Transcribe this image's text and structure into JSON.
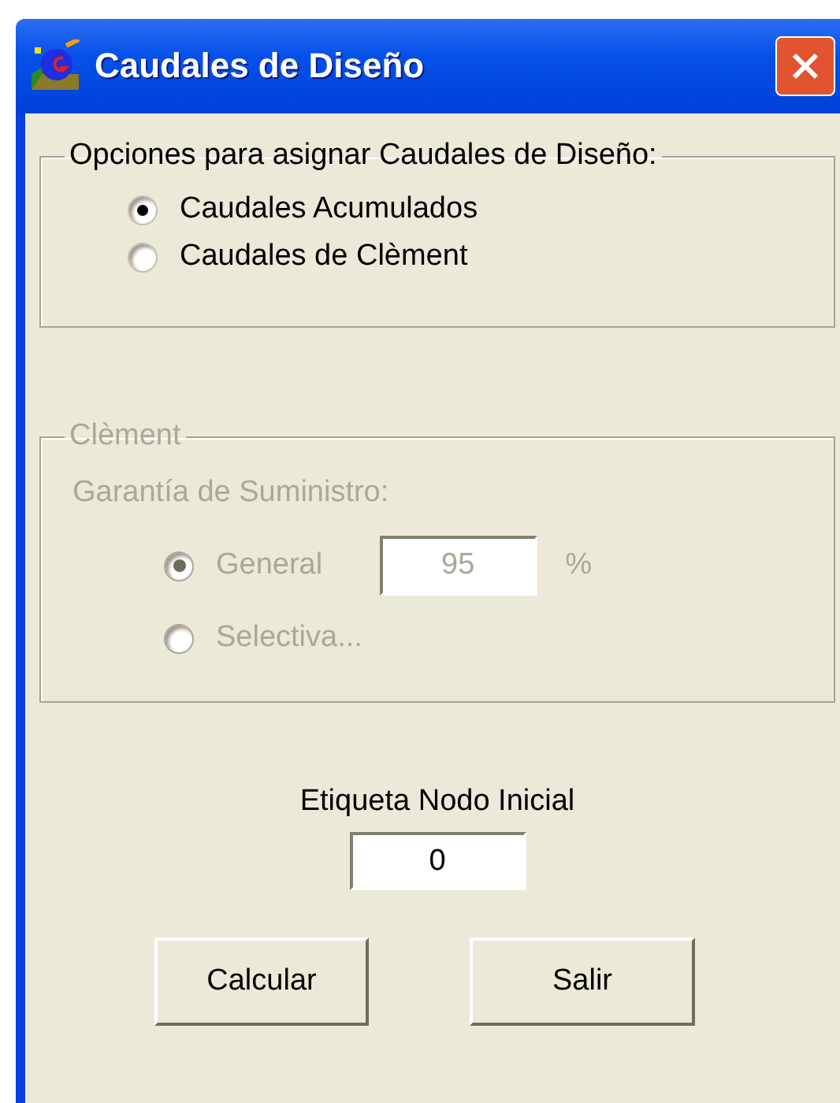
{
  "window": {
    "title": "Caudales de Diseño"
  },
  "options_group": {
    "title": "Opciones para asignar Caudales de Diseño:",
    "disabled": false,
    "radios": [
      {
        "label": "Caudales Acumulados",
        "selected": true
      },
      {
        "label": "Caudales de Clèment",
        "selected": false
      }
    ]
  },
  "clement_group": {
    "title": "Clèment",
    "disabled": true,
    "subtitle": "Garantía de Suministro:",
    "radios": [
      {
        "label": "General",
        "selected": true,
        "value": "95",
        "unit": "%"
      },
      {
        "label": "Selectiva...",
        "selected": false
      }
    ]
  },
  "start_node": {
    "label": "Etiqueta Nodo Inicial",
    "value": "0"
  },
  "buttons": [
    "Calcular",
    "Salir"
  ]
}
